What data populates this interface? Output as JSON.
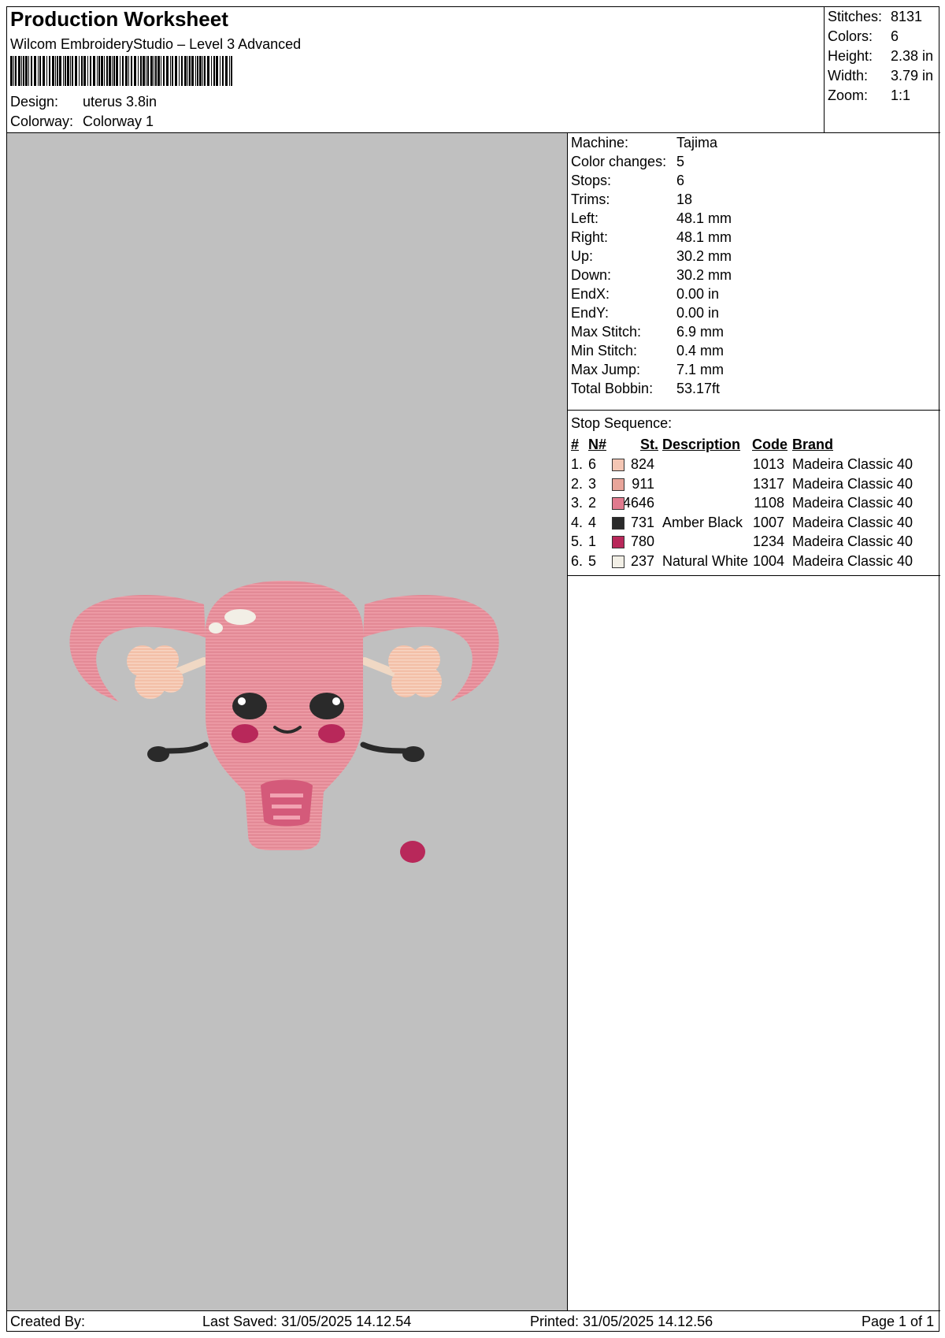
{
  "header": {
    "title": "Production Worksheet",
    "subtitle": "Wilcom EmbroideryStudio – Level 3 Advanced",
    "design_label": "Design:",
    "design_value": "uterus 3.8in",
    "colorway_label": "Colorway:",
    "colorway_value": "Colorway 1"
  },
  "summary": [
    {
      "label": "Stitches:",
      "value": "8131"
    },
    {
      "label": "Colors:",
      "value": "6"
    },
    {
      "label": "Height:",
      "value": "2.38 in"
    },
    {
      "label": "Width:",
      "value": "3.79 in"
    },
    {
      "label": "Zoom:",
      "value": "1:1"
    }
  ],
  "machine_info": [
    {
      "label": "Machine:",
      "value": "Tajima"
    },
    {
      "label": "Color changes:",
      "value": "5"
    },
    {
      "label": "Stops:",
      "value": "6"
    },
    {
      "label": "Trims:",
      "value": "18"
    },
    {
      "label": "Left:",
      "value": "48.1 mm"
    },
    {
      "label": "Right:",
      "value": "48.1 mm"
    },
    {
      "label": "Up:",
      "value": "30.2 mm"
    },
    {
      "label": "Down:",
      "value": "30.2 mm"
    },
    {
      "label": "EndX:",
      "value": "0.00 in"
    },
    {
      "label": "EndY:",
      "value": "0.00 in"
    },
    {
      "label": "Max Stitch:",
      "value": "6.9 mm"
    },
    {
      "label": "Min Stitch:",
      "value": "0.4 mm"
    },
    {
      "label": "Max Jump:",
      "value": "7.1 mm"
    },
    {
      "label": "Total Bobbin:",
      "value": "53.17ft"
    }
  ],
  "stop_sequence": {
    "title": "Stop Sequence:",
    "columns": {
      "num": "#",
      "needle": "N#",
      "stitches": "St.",
      "description": "Description",
      "code": "Code",
      "brand": "Brand"
    },
    "rows": [
      {
        "num": "1.",
        "needle": "6",
        "color": "#f4c6b4",
        "stitches": "824",
        "description": "",
        "code": "1013",
        "brand": "Madeira Classic 40"
      },
      {
        "num": "2.",
        "needle": "3",
        "color": "#e8a59a",
        "stitches": "911",
        "description": "",
        "code": "1317",
        "brand": "Madeira Classic 40"
      },
      {
        "num": "3.",
        "needle": "2",
        "color": "#e07a8e",
        "stitches": "4646",
        "description": "",
        "code": "1108",
        "brand": "Madeira Classic 40"
      },
      {
        "num": "4.",
        "needle": "4",
        "color": "#2a2a2a",
        "stitches": "731",
        "description": "Amber Black",
        "code": "1007",
        "brand": "Madeira Classic 40"
      },
      {
        "num": "5.",
        "needle": "1",
        "color": "#b8285a",
        "stitches": "780",
        "description": "",
        "code": "1234",
        "brand": "Madeira Classic 40"
      },
      {
        "num": "6.",
        "needle": "5",
        "color": "#f2efe6",
        "stitches": "237",
        "description": "Natural White",
        "code": "1004",
        "brand": "Madeira Classic 40"
      }
    ]
  },
  "footer": {
    "created_by": "Created By:",
    "last_saved": "Last Saved: 31/05/2025 14.12.54",
    "printed": "Printed: 31/05/2025 14.12.56",
    "page": "Page 1 of 1"
  }
}
